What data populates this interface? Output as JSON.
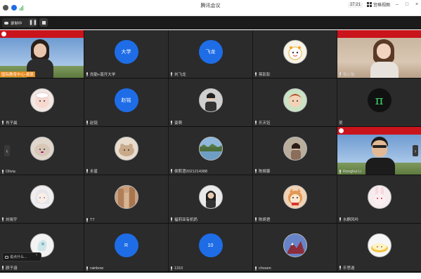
{
  "window": {
    "title": "腾讯会议",
    "timer": "27:21",
    "view_label": "宫格视图"
  },
  "recording": {
    "label": "录制中"
  },
  "tiles": [
    {
      "name": "国际教育中心-梁恩",
      "kind": "video-left",
      "label": "国际教育中心-梁恩"
    },
    {
      "name": "尚勤+南开大学",
      "kind": "text",
      "avatar_text": "大学"
    },
    {
      "name": "刘飞龙",
      "kind": "text",
      "avatar_text": "飞龙"
    },
    {
      "name": "蒋彭彭",
      "kind": "pic",
      "avatar_color": "#f7f3e6"
    },
    {
      "name": "张心怡",
      "kind": "video-right"
    },
    {
      "name": "肖子晨",
      "kind": "pic",
      "avatar_color": "#f2e7e2"
    },
    {
      "name": "赵铭",
      "kind": "text",
      "avatar_text": "赵铭"
    },
    {
      "name": "姿萌",
      "kind": "pic",
      "avatar_color": "#dcdcdc"
    },
    {
      "name": "乐天钰",
      "kind": "pic",
      "avatar_color": "#c9e3c4"
    },
    {
      "name": "吴",
      "kind": "pi"
    },
    {
      "name": "Olivia",
      "kind": "pic",
      "avatar_color": "#e0d6cc"
    },
    {
      "name": "永星",
      "kind": "pic",
      "avatar_color": "#e8dccf"
    },
    {
      "name": "侯熙澄2021214388",
      "kind": "pic",
      "avatar_color": "#7fa9c7"
    },
    {
      "name": "陈婉蓁",
      "kind": "pic",
      "avatar_color": "#a99c8c"
    },
    {
      "name": "Ronghui Li",
      "kind": "video-right2"
    },
    {
      "name": "刘晓宇",
      "kind": "pic",
      "avatar_color": "#f0eeee"
    },
    {
      "name": "TT",
      "kind": "pic",
      "avatar_color": "#b98f6f"
    },
    {
      "name": "福莉亚有机奶",
      "kind": "pic",
      "avatar_color": "#e6e6e6"
    },
    {
      "name": "陈妍君",
      "kind": "pic",
      "avatar_color": "#f1d2b4"
    },
    {
      "name": "水麒风吟",
      "kind": "pic",
      "avatar_color": "#f6ecee"
    },
    {
      "name": "颜子涵",
      "kind": "pic",
      "avatar_color": "#f3f3f3"
    },
    {
      "name": "rainbow",
      "kind": "text",
      "avatar_text": "R"
    },
    {
      "name": "1310",
      "kind": "text",
      "avatar_text": "10"
    },
    {
      "name": "chosen",
      "kind": "pic",
      "avatar_color": "#5e7cc6"
    },
    {
      "name": "乐思逍",
      "kind": "pic",
      "avatar_color": "#f6f6f6"
    }
  ],
  "chat": {
    "placeholder": "说点什么..."
  },
  "colors": {
    "accent": "#1e6de7",
    "tile_bg": "#2b2b2b",
    "banner_red": "#c9141c"
  }
}
